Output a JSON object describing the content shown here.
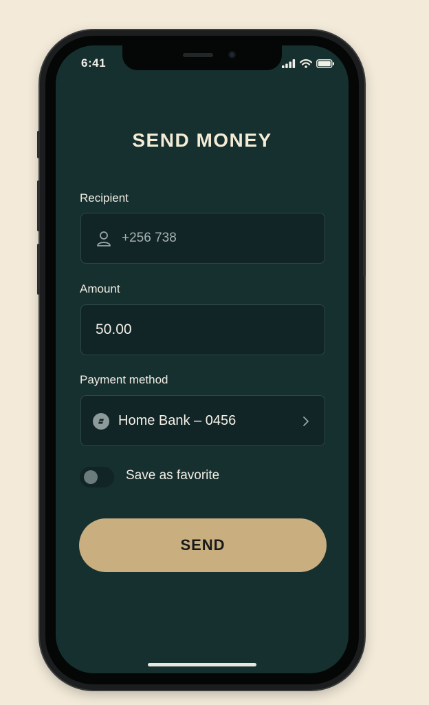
{
  "status_bar": {
    "time": "6:41",
    "icons": [
      "cellular-signal-icon",
      "wifi-icon",
      "battery-icon"
    ]
  },
  "screen": {
    "title": "SEND MONEY"
  },
  "recipient": {
    "label": "Recipient",
    "value": "+256 738",
    "icon": "person-icon"
  },
  "amount": {
    "label": "Amount",
    "value": "50.00"
  },
  "payment_method": {
    "label": "Payment method",
    "selected": "Home Bank – 0456",
    "icon": "bank-icon",
    "chevron": "chevron-right-icon"
  },
  "favorite": {
    "label": "Save as favorite",
    "on": false
  },
  "actions": {
    "send_label": "SEND"
  },
  "colors": {
    "page_background": "#f3ead9",
    "screen_background": "#16302f",
    "field_background": "#112526",
    "accent": "#c9ae80",
    "text_primary": "#f1ede4"
  }
}
